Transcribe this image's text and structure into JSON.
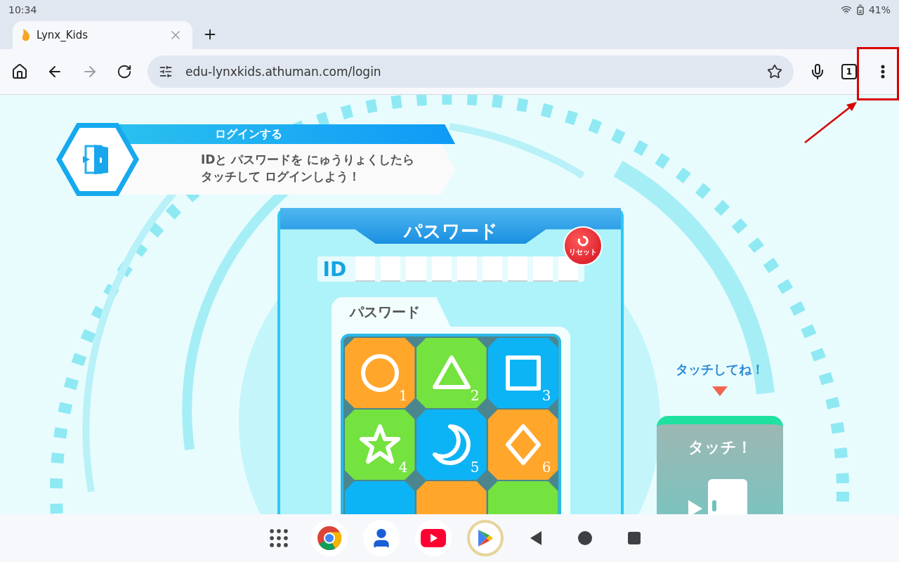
{
  "status_bar": {
    "time": "10:34",
    "battery": "41%"
  },
  "browser_tab": {
    "title": "Lynx_Kids"
  },
  "toolbar": {
    "back_disabled": false,
    "forward_disabled": true,
    "url": "edu-lynxkids.athuman.com/login",
    "tab_count": "1"
  },
  "banner": {
    "heading": "ログインする",
    "message_lines": [
      "IDと パスワードを にゅうりょくしたら",
      "タッチして ログインしよう！"
    ]
  },
  "panel": {
    "title": "パスワード",
    "reset_label": "リセット",
    "id_label": "ID",
    "password_label": "パスワード",
    "tiles": [
      {
        "kind": "circle",
        "color": "#ffa62b",
        "number": "1"
      },
      {
        "kind": "triangle",
        "color": "#74e23f",
        "number": "2"
      },
      {
        "kind": "square",
        "color": "#0db4f5",
        "number": "3"
      },
      {
        "kind": "star",
        "color": "#74e23f",
        "number": "4"
      },
      {
        "kind": "moon",
        "color": "#0db4f5",
        "number": "5"
      },
      {
        "kind": "diamond",
        "color": "#ffa62b",
        "number": "6"
      },
      {
        "kind": "hidden",
        "color": "#0db4f5"
      },
      {
        "kind": "hidden",
        "color": "#ffa62b"
      },
      {
        "kind": "hidden",
        "color": "#74e23f"
      }
    ]
  },
  "touch": {
    "hint": "タッチしてね！",
    "label": "タッチ！"
  }
}
